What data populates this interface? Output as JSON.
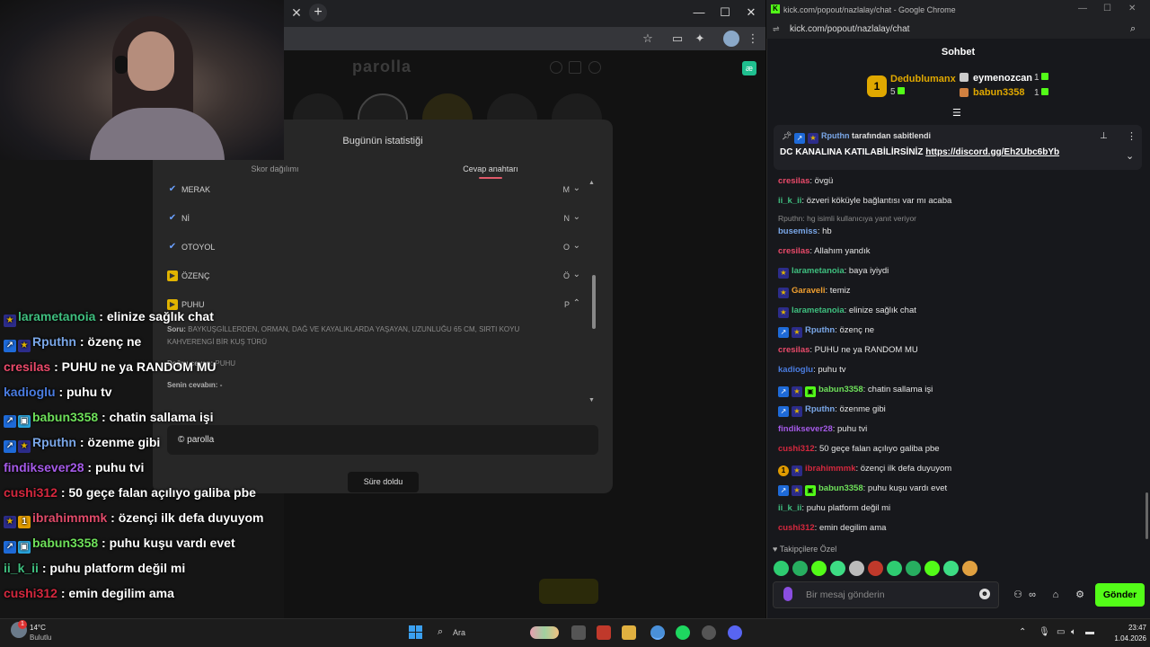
{
  "left_browser": {
    "parolla_logo": "parolla",
    "modal": {
      "title": "Bugünün istatistiği",
      "tabs": [
        "Skor dağılımı",
        "Cevap anahtarı"
      ],
      "answers": [
        {
          "word": "MERAK",
          "letter": "M",
          "status": "correct"
        },
        {
          "word": "Nİ",
          "letter": "N",
          "status": "correct"
        },
        {
          "word": "OTOYOL",
          "letter": "O",
          "status": "correct"
        },
        {
          "word": "ÖZENÇ",
          "letter": "Ö",
          "status": "passed"
        },
        {
          "word": "PUHU",
          "letter": "P",
          "status": "passed"
        }
      ],
      "detail": {
        "question_label": "Soru:",
        "question": "BAYKUŞGİLLERDEN, ORMAN, DAĞ VE KAYALIKLARDA YAŞAYAN, UZUNLUĞU 65 CM, SIRTI KOYU KAHVERENGİ BİR KUŞ TÜRÜ",
        "correct_label": "Doğru cevap:",
        "correct_answer": "PUHU",
        "your_label": "Senin cevabın:",
        "your_answer": "-"
      },
      "copyright": "© parolla",
      "time_up_button": "Süre doldu"
    }
  },
  "stream_overlay": {
    "messages": [
      {
        "user": "larametanoia",
        "text": ": elinize sağlık chat",
        "color": "#3fbf7f",
        "badges": [
          "star"
        ]
      },
      {
        "user": "Rputhn",
        "text": ": özenç ne",
        "color": "#7aa7e8",
        "badges": [
          "rocket",
          "star"
        ]
      },
      {
        "user": "cresilas",
        "text": ": PUHU ne ya RANDOM MU",
        "color": "#ea4a6a",
        "badges": []
      },
      {
        "user": "kadioglu",
        "text": ": puhu tv",
        "color": "#4a7ce0",
        "badges": []
      },
      {
        "user": "babun3358",
        "text": ": chatin sallama işi",
        "color": "#6ee05a",
        "badges": [
          "rocket",
          "gift"
        ]
      },
      {
        "user": "Rputhn",
        "text": ": özenme gibi",
        "color": "#7aa7e8",
        "badges": [
          "rocket",
          "star"
        ]
      },
      {
        "user": "findiksever28",
        "text": ": puhu tvi",
        "color": "#a55ae8",
        "badges": []
      },
      {
        "user": "cushi312",
        "text": ": 50 geçe falan açılıyo galiba pbe",
        "color": "#d4283e",
        "badges": []
      },
      {
        "user": "ibrahimmmk",
        "text": ": özençi ilk defa duyuyom",
        "color": "#e04b6a",
        "badges": [
          "star",
          "one"
        ]
      },
      {
        "user": "babun3358",
        "text": ": puhu kuşu vardı evet",
        "color": "#6ee05a",
        "badges": [
          "rocket",
          "gift"
        ]
      },
      {
        "user": "ii_k_ii",
        "text": ": puhu platform değil mi",
        "color": "#3fbf7f",
        "badges": []
      },
      {
        "user": "cushi312",
        "text": ": emin degilim ama",
        "color": "#d4283e",
        "badges": []
      }
    ]
  },
  "chat_window": {
    "title": "kick.com/popout/nazlalay/chat - Google Chrome",
    "url": "kick.com/popout/nazlalay/chat",
    "header": "Sohbet",
    "leaderboard": {
      "first": {
        "rank": "1",
        "name": "Dedublumanx",
        "count": "5"
      },
      "second": {
        "name": "eymenozcan",
        "count": "1"
      },
      "third": {
        "name": "babun3358",
        "count": "1"
      }
    },
    "pinned": {
      "by_user": "Rputhn",
      "by_suffix": " tarafından sabitlendi",
      "text": "DC KANALINA KATILABİLİRSİNİZ ",
      "link": "https://discord.gg/Eh2Ubc6bYb"
    },
    "reply_hint": "Rputhn: hg isimli kullanıcıya yanıt veriyor",
    "messages": [
      {
        "user": "cresilas",
        "text": ": övgü",
        "color": "#ea4a6a",
        "badges": []
      },
      {
        "user": "ii_k_ii",
        "text": ": özveri köküyle bağlantısı var mı acaba",
        "color": "#3fbf7f",
        "badges": []
      },
      {
        "user": "busemiss",
        "text": ": hb",
        "color": "#7aa7e8",
        "badges": []
      },
      {
        "user": "cresilas",
        "text": ": Allahım yandık",
        "color": "#ea4a6a",
        "badges": []
      },
      {
        "user": "larametanoia",
        "text": ": baya iyiydi",
        "color": "#3fbf7f",
        "badges": [
          "star"
        ]
      },
      {
        "user": "Garaveli",
        "text": ": temiz",
        "color": "#f0a030",
        "badges": [
          "star"
        ]
      },
      {
        "user": "larametanoia",
        "text": ": elinize sağlık chat",
        "color": "#3fbf7f",
        "badges": [
          "star"
        ]
      },
      {
        "user": "Rputhn",
        "text": ": özenç ne",
        "color": "#7aa7e8",
        "badges": [
          "rocket",
          "star"
        ]
      },
      {
        "user": "cresilas",
        "text": ": PUHU ne ya RANDOM MU",
        "color": "#ea4a6a",
        "badges": []
      },
      {
        "user": "kadioglu",
        "text": ": puhu tv",
        "color": "#4a7ce0",
        "badges": []
      },
      {
        "user": "babun3358",
        "text": ": chatin sallama işi",
        "color": "#6ee05a",
        "badges": [
          "rocket",
          "star",
          "gift"
        ]
      },
      {
        "user": "Rputhn",
        "text": ": özenme gibi",
        "color": "#7aa7e8",
        "badges": [
          "rocket",
          "star"
        ]
      },
      {
        "user": "findiksever28",
        "text": ": puhu tvi",
        "color": "#a55ae8",
        "badges": []
      },
      {
        "user": "cushi312",
        "text": ": 50 geçe falan açılıyo galiba pbe",
        "color": "#d4283e",
        "badges": []
      },
      {
        "user": "ibrahimmmk",
        "text": ": özençi ilk defa duyuyom",
        "color": "#d4283e",
        "badges": [
          "one",
          "star"
        ]
      },
      {
        "user": "babun3358",
        "text": ": puhu kuşu vardı evet",
        "color": "#6ee05a",
        "badges": [
          "rocket",
          "star",
          "gift"
        ]
      },
      {
        "user": "ii_k_ii",
        "text": ": puhu platform değil mi",
        "color": "#3fbf7f",
        "badges": []
      },
      {
        "user": "cushi312",
        "text": ": emin degilim ama",
        "color": "#d4283e",
        "badges": []
      }
    ],
    "follower_only": "Takipçilere Özel",
    "input_placeholder": "Bir mesaj gönderin",
    "send_button": "Gönder"
  },
  "taskbar": {
    "temperature": "14°C",
    "weather": "Bulutlu",
    "weather_badge": "1",
    "search_placeholder": "Ara",
    "time": "23:47",
    "date": "1.04.2026"
  },
  "colors": {
    "kick_green": "#53fc18",
    "accent_pink": "#e05a6a"
  }
}
